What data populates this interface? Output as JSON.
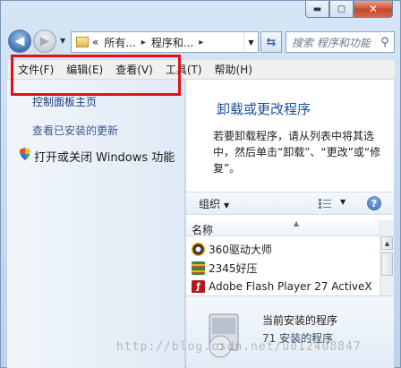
{
  "window": {
    "min_glyph": "▬",
    "max_glyph": "▢",
    "close_glyph": "✕"
  },
  "nav": {
    "back_glyph": "◀",
    "fwd_glyph": "▶",
    "breadcrumb": [
      "«",
      "所有...",
      "▸",
      "程序和...",
      "▸"
    ],
    "search_placeholder": "搜索 程序和功能"
  },
  "menu": [
    "文件(F)",
    "编辑(E)",
    "查看(V)",
    "工具(T)",
    "帮助(H)"
  ],
  "sidebar": {
    "home": "控制面板主页",
    "updates": "查看已安装的更新",
    "features": "打开或关闭 Windows 功能"
  },
  "main": {
    "title": "卸载或更改程序",
    "description": "若要卸载程序，请从列表中将其选中，然后单击“卸载”、“更改”或“修复”。"
  },
  "toolbar": {
    "organize": "组织",
    "help": "?"
  },
  "list": {
    "column_name": "名称",
    "items": [
      {
        "name": "360驱动大师",
        "icon": "360-icon"
      },
      {
        "name": "2345好压",
        "icon": "archive-icon"
      },
      {
        "name": "Adobe Flash Player 27 ActiveX",
        "icon": "flash-icon"
      }
    ]
  },
  "details": {
    "title": "当前安装的程序",
    "count": "71 安装的程序"
  },
  "watermark": "http://blog.csdn.net/u012408847",
  "colors": {
    "accent": "#1a4f9e",
    "highlight_border": "#e3101a"
  }
}
